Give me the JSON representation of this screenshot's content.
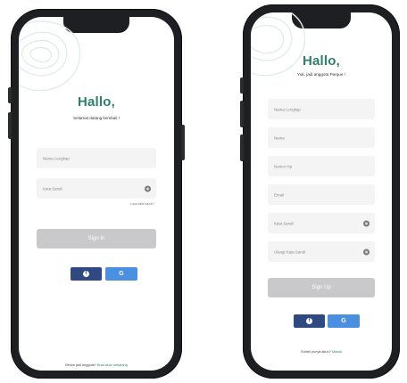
{
  "login": {
    "title": "Hallo,",
    "subtitle": "Selamat datang kembali !",
    "fullname_placeholder": "Nama Lengkap",
    "password_placeholder": "Kata Sandi",
    "forgot_password": "Lupa kata sandi?",
    "sign_in_label": "Sign In",
    "facebook_glyph": "f",
    "google_glyph": "G",
    "footer_text": "Belum jadi anggota? ",
    "footer_link": "Buat akun sekarang"
  },
  "register": {
    "title": "Hallo,",
    "subtitle": "Yuk, jadi anggota Parque !",
    "fullname_placeholder": "Nama Lengkap",
    "email_placeholder": "Nama",
    "phone_placeholder": "Nomor Hp",
    "email2_placeholder": "Email",
    "password_placeholder": "Kata Sandi",
    "confirm_password_placeholder": "Ulangi Kata Sandi",
    "sign_up_label": "Sign Up",
    "facebook_glyph": "f",
    "google_glyph": "G",
    "footer_text": "Sudah punya akun? ",
    "footer_link": "Masuk"
  },
  "colors": {
    "brand": "#2f7f6b",
    "facebook": "#2f4a82",
    "google": "#4a8fe0",
    "disabled_button": "#c9c9cb"
  }
}
